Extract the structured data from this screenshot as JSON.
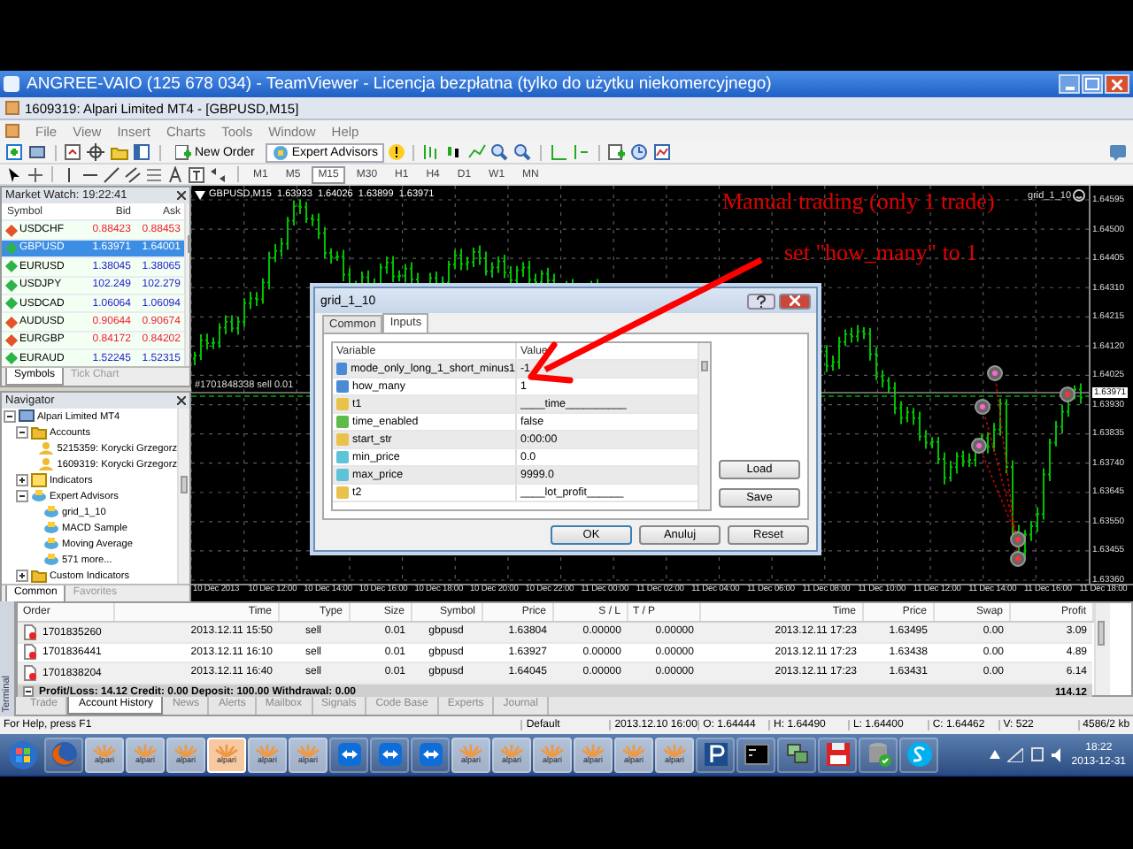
{
  "remote_window": {
    "title": "ANGREE-VAIO (125 678 034) - TeamViewer - Licencja bezpłatna (tylko do użytku niekomercyjnego)"
  },
  "app_window": {
    "title": "1609319: Alpari Limited MT4 - [GBPUSD,M15]"
  },
  "menu": [
    "File",
    "View",
    "Insert",
    "Charts",
    "Tools",
    "Window",
    "Help"
  ],
  "toolbar": {
    "buttons": [
      {
        "label": "New Order",
        "on": false
      },
      {
        "label": "Expert Advisors",
        "on": true
      }
    ]
  },
  "timeframes": [
    {
      "label": "M1",
      "selected": false
    },
    {
      "label": "M5",
      "selected": false
    },
    {
      "label": "M15",
      "selected": true
    },
    {
      "label": "M30",
      "selected": false
    },
    {
      "label": "H1",
      "selected": false
    },
    {
      "label": "H4",
      "selected": false
    },
    {
      "label": "D1",
      "selected": false
    },
    {
      "label": "W1",
      "selected": false
    },
    {
      "label": "MN",
      "selected": false
    }
  ],
  "market_watch": {
    "title": "Market Watch: 19:22:41",
    "columns": [
      "Symbol",
      "Bid",
      "Ask"
    ],
    "rows": [
      {
        "symbol": "USDCHF",
        "bid": "0.88423",
        "ask": "0.88453",
        "down": true,
        "selected": false
      },
      {
        "symbol": "GBPUSD",
        "bid": "1.63971",
        "ask": "1.64001",
        "down": false,
        "selected": true
      },
      {
        "symbol": "EURUSD",
        "bid": "1.38045",
        "ask": "1.38065",
        "down": false,
        "selected": false
      },
      {
        "symbol": "USDJPY",
        "bid": "102.249",
        "ask": "102.279",
        "down": false,
        "selected": false
      },
      {
        "symbol": "USDCAD",
        "bid": "1.06064",
        "ask": "1.06094",
        "down": false,
        "selected": false
      },
      {
        "symbol": "AUDUSD",
        "bid": "0.90644",
        "ask": "0.90674",
        "down": true,
        "selected": false
      },
      {
        "symbol": "EURGBP",
        "bid": "0.84172",
        "ask": "0.84202",
        "down": true,
        "selected": false
      },
      {
        "symbol": "EURAUD",
        "bid": "1.52245",
        "ask": "1.52315",
        "down": false,
        "selected": false
      }
    ],
    "tabs": [
      {
        "label": "Symbols",
        "selected": true
      },
      {
        "label": "Tick Chart",
        "selected": false
      }
    ]
  },
  "navigator": {
    "title": "Navigator",
    "tree": [
      {
        "label": "Alpari Limited MT4",
        "kind": "terminal",
        "expanded": true,
        "children": [
          {
            "label": "Accounts",
            "kind": "folder",
            "expanded": true,
            "children": [
              {
                "label": "5215359: Korycki Grzegorz",
                "kind": "account"
              },
              {
                "label": "1609319: Korycki Grzegorz",
                "kind": "account"
              }
            ]
          },
          {
            "label": "Indicators",
            "kind": "indicators",
            "expanded": false
          },
          {
            "label": "Expert Advisors",
            "kind": "experts",
            "expanded": true,
            "children": [
              {
                "label": "grid_1_10",
                "kind": "expert"
              },
              {
                "label": "MACD Sample",
                "kind": "expert"
              },
              {
                "label": "Moving Average",
                "kind": "expert"
              },
              {
                "label": "571 more...",
                "kind": "expert"
              }
            ]
          },
          {
            "label": "Custom Indicators",
            "kind": "folder",
            "expanded": false
          }
        ]
      }
    ],
    "tabs": [
      {
        "label": "Common",
        "selected": true
      },
      {
        "label": "Favorites",
        "selected": false
      }
    ]
  },
  "chart": {
    "header": "GBPUSD,M15  1.63933  1.64026  1.63899  1.63971",
    "order_label": "#1701848338 sell 0.01",
    "ea_label": "grid_1_10",
    "annotations": [
      "Manual trading (only 1 trade)",
      "set \"how_many\" to 1"
    ],
    "price_axis": [
      "1.64595",
      "1.64500",
      "1.64405",
      "1.64310",
      "1.64215",
      "1.64120",
      "1.64025",
      "1.63930",
      "1.63835",
      "1.63740",
      "1.63645",
      "1.63550",
      "1.63455",
      "1.63360"
    ],
    "bid_price": "1.63971",
    "time_axis": [
      "10 Dec 2013",
      "10 Dec 12:00",
      "10 Dec 14:00",
      "10 Dec 16:00",
      "10 Dec 18:00",
      "10 Dec 20:00",
      "10 Dec 22:00",
      "11 Dec 00:00",
      "11 Dec 02:00",
      "11 Dec 04:00",
      "11 Dec 06:00",
      "11 Dec 08:00",
      "11 Dec 10:00",
      "11 Dec 12:00",
      "11 Dec 14:00",
      "11 Dec 16:00",
      "11 Dec 18:00"
    ]
  },
  "dialog": {
    "title": "grid_1_10",
    "tabs": [
      {
        "label": "Common",
        "selected": false
      },
      {
        "label": "Inputs",
        "selected": true
      }
    ],
    "columns": [
      "Variable",
      "Value"
    ],
    "rows": [
      {
        "kind": "int",
        "variable": "mode_only_long_1_short_minus1",
        "value": "-1"
      },
      {
        "kind": "int",
        "variable": "how_many",
        "value": "1"
      },
      {
        "kind": "string",
        "variable": "t1",
        "value": "____time__________"
      },
      {
        "kind": "bool",
        "variable": "time_enabled",
        "value": "false"
      },
      {
        "kind": "string",
        "variable": "start_str",
        "value": "0:00:00"
      },
      {
        "kind": "double",
        "variable": "min_price",
        "value": "0.0"
      },
      {
        "kind": "double",
        "variable": "max_price",
        "value": "9999.0"
      },
      {
        "kind": "string",
        "variable": "t2",
        "value": "____lot_profit______"
      }
    ],
    "side_buttons": [
      "Load",
      "Save"
    ],
    "buttons": [
      "OK",
      "Anuluj",
      "Reset"
    ]
  },
  "terminal": {
    "label": "Terminal",
    "columns": [
      "Order",
      "Time",
      "Type",
      "Size",
      "Symbol",
      "Price",
      "S / L",
      "T / P",
      "Time",
      "Price",
      "Swap",
      "Profit"
    ],
    "rows": [
      [
        "1701835260",
        "2013.12.11 15:50",
        "sell",
        "0.01",
        "gbpusd",
        "1.63804",
        "0.00000",
        "0.00000",
        "2013.12.11 17:23",
        "1.63495",
        "0.00",
        "3.09"
      ],
      [
        "1701836441",
        "2013.12.11 16:10",
        "sell",
        "0.01",
        "gbpusd",
        "1.63927",
        "0.00000",
        "0.00000",
        "2013.12.11 17:23",
        "1.63438",
        "0.00",
        "4.89"
      ],
      [
        "1701838204",
        "2013.12.11 16:40",
        "sell",
        "0.01",
        "gbpusd",
        "1.64045",
        "0.00000",
        "0.00000",
        "2013.12.11 17:23",
        "1.63431",
        "0.00",
        "6.14"
      ]
    ],
    "summary": "Profit/Loss: 14.12  Credit: 0.00  Deposit: 100.00  Withdrawal: 0.00",
    "total": "114.12",
    "tabs": [
      {
        "label": "Trade",
        "selected": false
      },
      {
        "label": "Account History",
        "selected": true
      },
      {
        "label": "News",
        "selected": false
      },
      {
        "label": "Alerts",
        "selected": false
      },
      {
        "label": "Mailbox",
        "selected": false
      },
      {
        "label": "Signals",
        "selected": false
      },
      {
        "label": "Code Base",
        "selected": false
      },
      {
        "label": "Experts",
        "selected": false
      },
      {
        "label": "Journal",
        "selected": false
      }
    ]
  },
  "status_bar": [
    "For Help, press F1",
    "Default",
    "2013.12.10 16:00",
    "O: 1.64444",
    "H: 1.64490",
    "L: 1.64400",
    "C: 1.64462",
    "V: 522",
    "4586/2 kb"
  ],
  "taskbar": {
    "items": [
      {
        "kind": "start",
        "selected": false
      },
      {
        "kind": "firefox",
        "selected": false
      },
      {
        "kind": "alpari",
        "label": "alpari",
        "selected": false
      },
      {
        "kind": "alpari",
        "label": "alpari",
        "selected": false
      },
      {
        "kind": "alpari",
        "label": "alpari",
        "selected": false
      },
      {
        "kind": "alpari",
        "label": "alpari",
        "selected": true
      },
      {
        "kind": "alpari",
        "label": "alpari",
        "selected": false
      },
      {
        "kind": "alpari",
        "label": "alpari",
        "selected": false
      },
      {
        "kind": "teamviewer",
        "selected": false
      },
      {
        "kind": "teamviewer",
        "selected": false
      },
      {
        "kind": "teamviewer",
        "selected": false
      },
      {
        "kind": "alpari",
        "label": "alpari",
        "selected": false
      },
      {
        "kind": "alpari",
        "label": "alpari",
        "selected": false
      },
      {
        "kind": "alpari",
        "label": "alpari",
        "selected": false
      },
      {
        "kind": "alpari",
        "label": "alpari",
        "selected": false
      },
      {
        "kind": "alpari",
        "label": "alpari",
        "selected": false
      },
      {
        "kind": "alpari",
        "label": "alpari",
        "selected": false
      },
      {
        "kind": "putty",
        "selected": false
      },
      {
        "kind": "console",
        "selected": false
      },
      {
        "kind": "network",
        "selected": false
      },
      {
        "kind": "floppy",
        "selected": false
      },
      {
        "kind": "database",
        "selected": false
      },
      {
        "kind": "skype",
        "selected": false
      }
    ],
    "time": "18:22",
    "date": "2013-12-31"
  }
}
